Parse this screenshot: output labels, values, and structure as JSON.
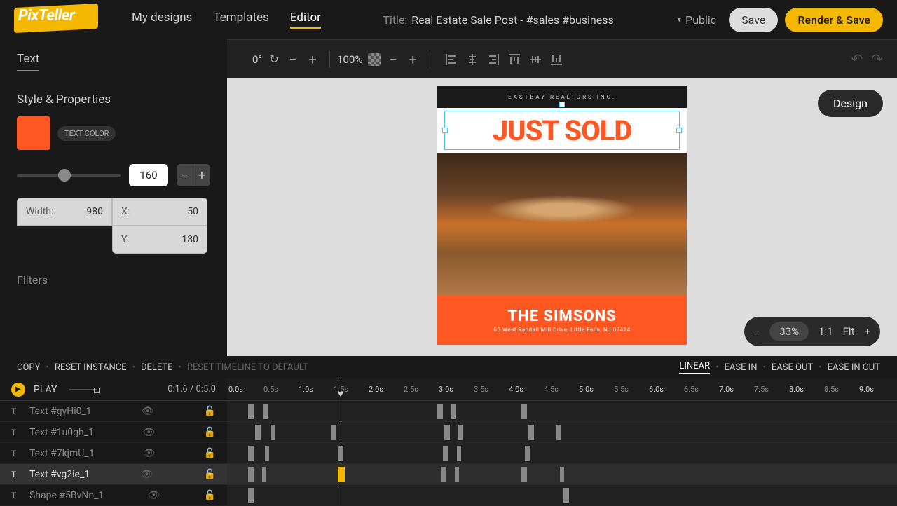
{
  "logo": "PixTeller",
  "nav": {
    "mydesigns": "My designs",
    "templates": "Templates",
    "editor": "Editor"
  },
  "title": {
    "label": "Title:",
    "value": "Real Estate Sale Post - #sales #business"
  },
  "visibility": "Public",
  "buttons": {
    "save": "Save",
    "render": "Render & Save",
    "design": "Design"
  },
  "toolbar": {
    "rotation": "0°",
    "zoom": "100%"
  },
  "sidebar": {
    "text_section": "Text",
    "style_section": "Style & Properties",
    "text_color_chip": "TEXT COLOR",
    "size": "160",
    "width_label": "Width:",
    "width_val": "980",
    "x_label": "X:",
    "x_val": "50",
    "y_label": "Y:",
    "y_val": "130",
    "filters": "Filters",
    "swatch_color": "#ff5722"
  },
  "zoom": {
    "pct": "33%",
    "ratio": "1:1",
    "fit": "Fit"
  },
  "context": {
    "copy": "COPY",
    "reset_instance": "RESET INSTANCE",
    "delete": "DELETE",
    "reset_timeline": "RESET TIMELINE TO DEFAULT",
    "linear": "LINEAR",
    "ease_in": "EASE IN",
    "ease_out": "EASE OUT",
    "ease_in_out": "EASE IN OUT"
  },
  "timeline": {
    "play": "PLAY",
    "time": "0:1.6 / 0:5.0",
    "layers": [
      "Text #gyHi0_1",
      "Text #1u0gh_1",
      "Text #7kjmU_1",
      "Text #vg2ie_1",
      "Shape #5BvNn_1"
    ],
    "ticks": [
      {
        "t": "0.0s",
        "p": 2
      },
      {
        "t": "0.5s",
        "p": 52,
        "minor": true
      },
      {
        "t": "1.0s",
        "p": 102
      },
      {
        "t": "1.5s",
        "p": 152,
        "minor": true
      },
      {
        "t": "2.0s",
        "p": 202
      },
      {
        "t": "2.5s",
        "p": 252,
        "minor": true
      },
      {
        "t": "3.0s",
        "p": 302
      },
      {
        "t": "3.5s",
        "p": 352,
        "minor": true
      },
      {
        "t": "4.0s",
        "p": 402
      },
      {
        "t": "4.5s",
        "p": 452,
        "minor": true
      },
      {
        "t": "5.0s",
        "p": 502
      },
      {
        "t": "5.5s",
        "p": 552,
        "minor": true
      },
      {
        "t": "6.0s",
        "p": 602
      },
      {
        "t": "6.5s",
        "p": 652,
        "minor": true
      },
      {
        "t": "7.0s",
        "p": 702
      },
      {
        "t": "7.5s",
        "p": 752,
        "minor": true
      },
      {
        "t": "8.0s",
        "p": 802
      },
      {
        "t": "8.5s",
        "p": 852,
        "minor": true
      },
      {
        "t": "9.0s",
        "p": 902
      }
    ]
  },
  "card": {
    "realtor": "EASTBAY REALTORS INC.",
    "headline": "JUST SOLD",
    "family": "THE SIMSONS",
    "address": "65 West Randall Mill Drive, Little Falls, NJ 07424"
  }
}
